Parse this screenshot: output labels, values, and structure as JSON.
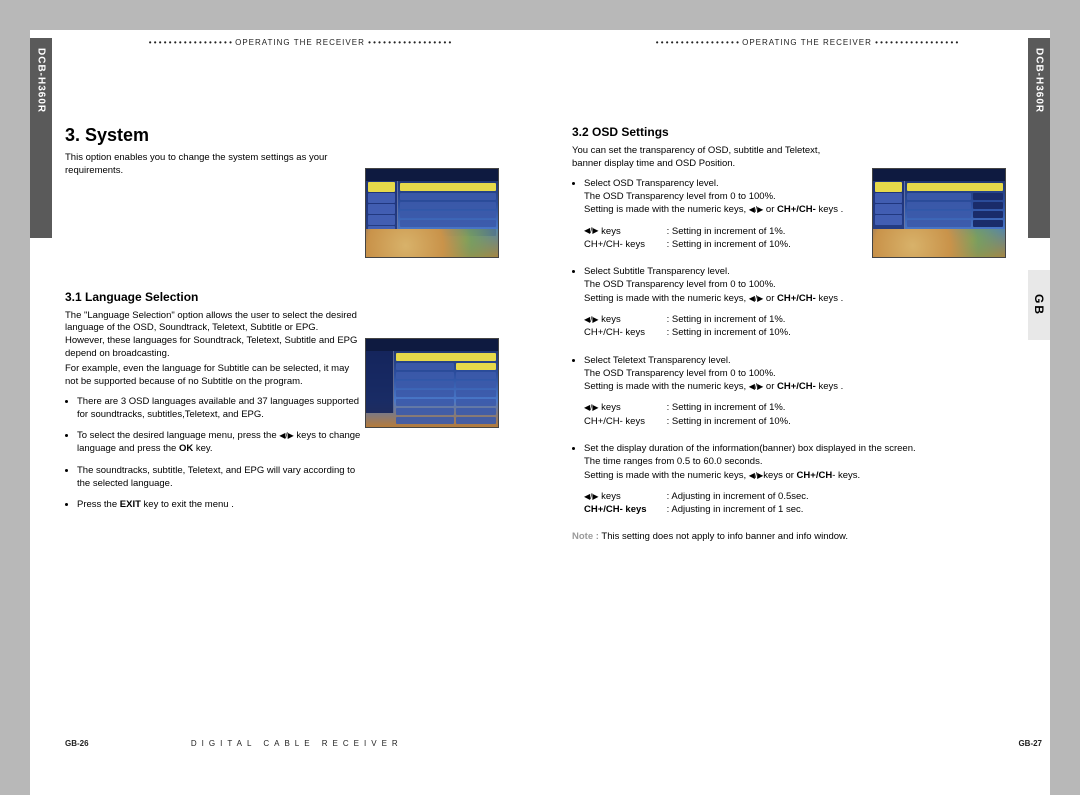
{
  "model": "DCB-H360R",
  "region_tab": "GB",
  "running_head": "OPERATING THE RECEIVER",
  "left": {
    "title": "3. System",
    "intro": "This option enables you to change the system settings as your requirements.",
    "sub1_title": "3.1 Language Selection",
    "sub1_p1": "The \"Language Selection\" option allows the user to select the desired language of the OSD, Soundtrack, Teletext, Subtitle or EPG. However, these languages for Soundtrack, Teletext, Subtitle and EPG depend on broadcasting.",
    "sub1_p2": "For example, even the language for Subtitle can be selected, it may not be supported because of no Subtitle on the program.",
    "b1": "There are 3 OSD languages available and 37 languages supported for soundtracks, subtitles,Teletext, and EPG.",
    "b2_a": "To select the desired language menu, press the ",
    "b2_b": " keys to change language and press the ",
    "b2_ok": "OK",
    "b2_c": " key.",
    "b3": "The soundtracks, subtitle, Teletext, and EPG will vary according to the selected language.",
    "b4_a": "Press the ",
    "b4_exit": "EXIT",
    "b4_b": " key to exit the menu .",
    "page_num": "GB-26"
  },
  "right": {
    "sub2_title": "3.2 OSD Settings",
    "sub2_p1": "You can set the transparency of OSD, subtitle and Teletext, banner display time and OSD Position.",
    "block1_l1": "Select OSD Transparency level.",
    "block1_l2": "The OSD Transparency level from 0 to 100%.",
    "block_setting_a": "Setting is made with the numeric keys, ",
    "block_setting_b": " or ",
    "block_setting_c": "CH+/CH-",
    "block_setting_d": " keys .",
    "keyrow_lr_label": "◀/▶ keys",
    "keyrow_lr_val": ": Setting in increment of 1%.",
    "keyrow_ch_label": "CH+/CH- keys",
    "keyrow_ch_val": ": Setting in increment of 10%.",
    "block2_l1": "Select Subtitle Transparency level.",
    "block3_l1": "Select Teletext Transparency level.",
    "block4_l1": "Set the display duration of the information(banner) box  displayed in the screen.",
    "block4_l2": "The time ranges from 0.5 to 60.0 seconds.",
    "block4_setting_a": "Setting is made with the numeric keys, ",
    "block4_setting_b": "keys  or ",
    "block4_setting_c": "CH+/CH",
    "block4_setting_d": "- keys.",
    "keyrow4_lr_val": ": Adjusting in increment of 0.5sec.",
    "keyrow4_ch_label": "CH+/CH- keys",
    "keyrow4_ch_val": ": Adjusting in increment of 1 sec.",
    "note_label": "Note :",
    "note_text": " This setting does not apply to info banner and info window.",
    "page_num": "GB-27"
  },
  "footer_center": "DIGITAL CABLE RECEIVER"
}
